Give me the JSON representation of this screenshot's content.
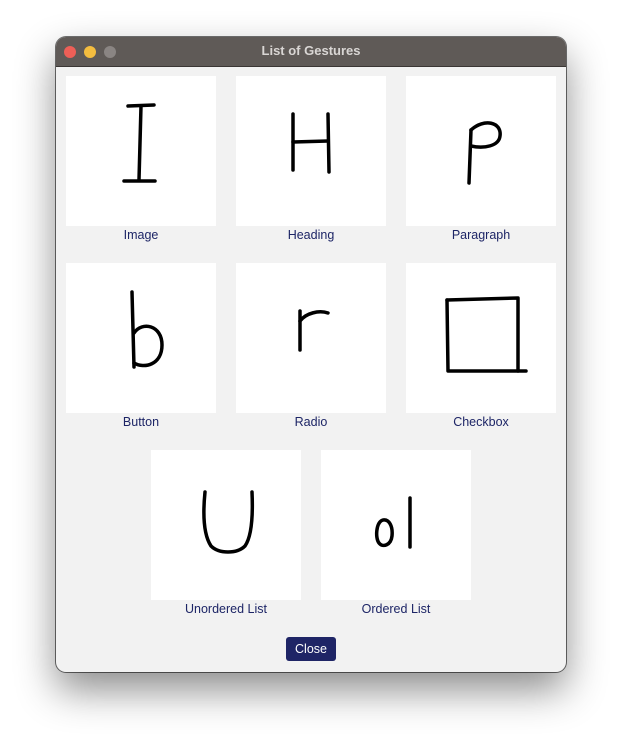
{
  "window": {
    "title": "List of Gestures"
  },
  "gestures": [
    {
      "label": "Image",
      "icon": "letter-I-gesture-icon"
    },
    {
      "label": "Heading",
      "icon": "letter-H-gesture-icon"
    },
    {
      "label": "Paragraph",
      "icon": "letter-P-gesture-icon"
    },
    {
      "label": "Button",
      "icon": "letter-b-gesture-icon"
    },
    {
      "label": "Radio",
      "icon": "letter-r-gesture-icon"
    },
    {
      "label": "Checkbox",
      "icon": "square-gesture-icon"
    },
    {
      "label": "Unordered List",
      "icon": "letter-U-gesture-icon"
    },
    {
      "label": "Ordered List",
      "icon": "letters-ol-gesture-icon"
    }
  ],
  "footer": {
    "close_label": "Close"
  },
  "colors": {
    "titlebar": "#5f5a57",
    "background": "#f2f2f2",
    "caption_text": "#1d2566",
    "button": "#1f2566"
  }
}
